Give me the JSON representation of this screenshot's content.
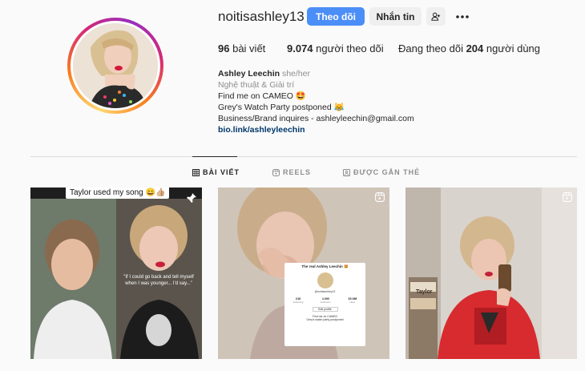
{
  "header": {
    "username": "noitisashley13",
    "follow_label": "Theo dõi",
    "message_label": "Nhắn tin"
  },
  "stats": {
    "posts_count": "96",
    "posts_label": "bài viết",
    "followers_count": "9.074",
    "followers_label": "người theo dõi",
    "following_prefix": "Đang theo dõi",
    "following_count": "204",
    "following_suffix": "người dùng"
  },
  "bio": {
    "name": "Ashley Leechin",
    "pronouns": "she/her",
    "category": "Nghệ thuật & Giải trí",
    "line1": "Find me on CAMEO 🤩",
    "line2": "Grey's Watch Party postponed 😹",
    "line3": "Business/Brand inquires - ashleyleechin@gmail.com",
    "link": "bio.link/ashleyleechin"
  },
  "tabs": [
    {
      "label": "BÀI VIẾT",
      "icon": "grid-icon",
      "active": true
    },
    {
      "label": "REELS",
      "icon": "reels-icon",
      "active": false
    },
    {
      "label": "ĐƯỢC GẮN THẺ",
      "icon": "tagged-icon",
      "active": false
    }
  ],
  "posts": [
    {
      "caption": "Taylor used my song 😄👍🏼",
      "overlay": "\"If I could go back and tell myself when I was younger... I'd say...\"",
      "badge": "pin-icon"
    },
    {
      "badge": "reels-icon",
      "card_title": "The real Ashley Leechin 🤩",
      "card_handle": "@noitisashley13",
      "card_stats": [
        {
          "value": "216",
          "label": "Following"
        },
        {
          "value": "1.0M",
          "label": "Followers"
        },
        {
          "value": "15.0M",
          "label": "Likes"
        }
      ],
      "card_button": "Edit profile",
      "card_bio1": "Find me on CAMEO",
      "card_bio2": "Grey's watch party postponed"
    },
    {
      "badge": "reels-icon",
      "shirt_text": "Taylor"
    }
  ],
  "colors": {
    "follow_button": "#4c8ef7",
    "link": "#00376b",
    "muted": "#8e8e8e"
  }
}
